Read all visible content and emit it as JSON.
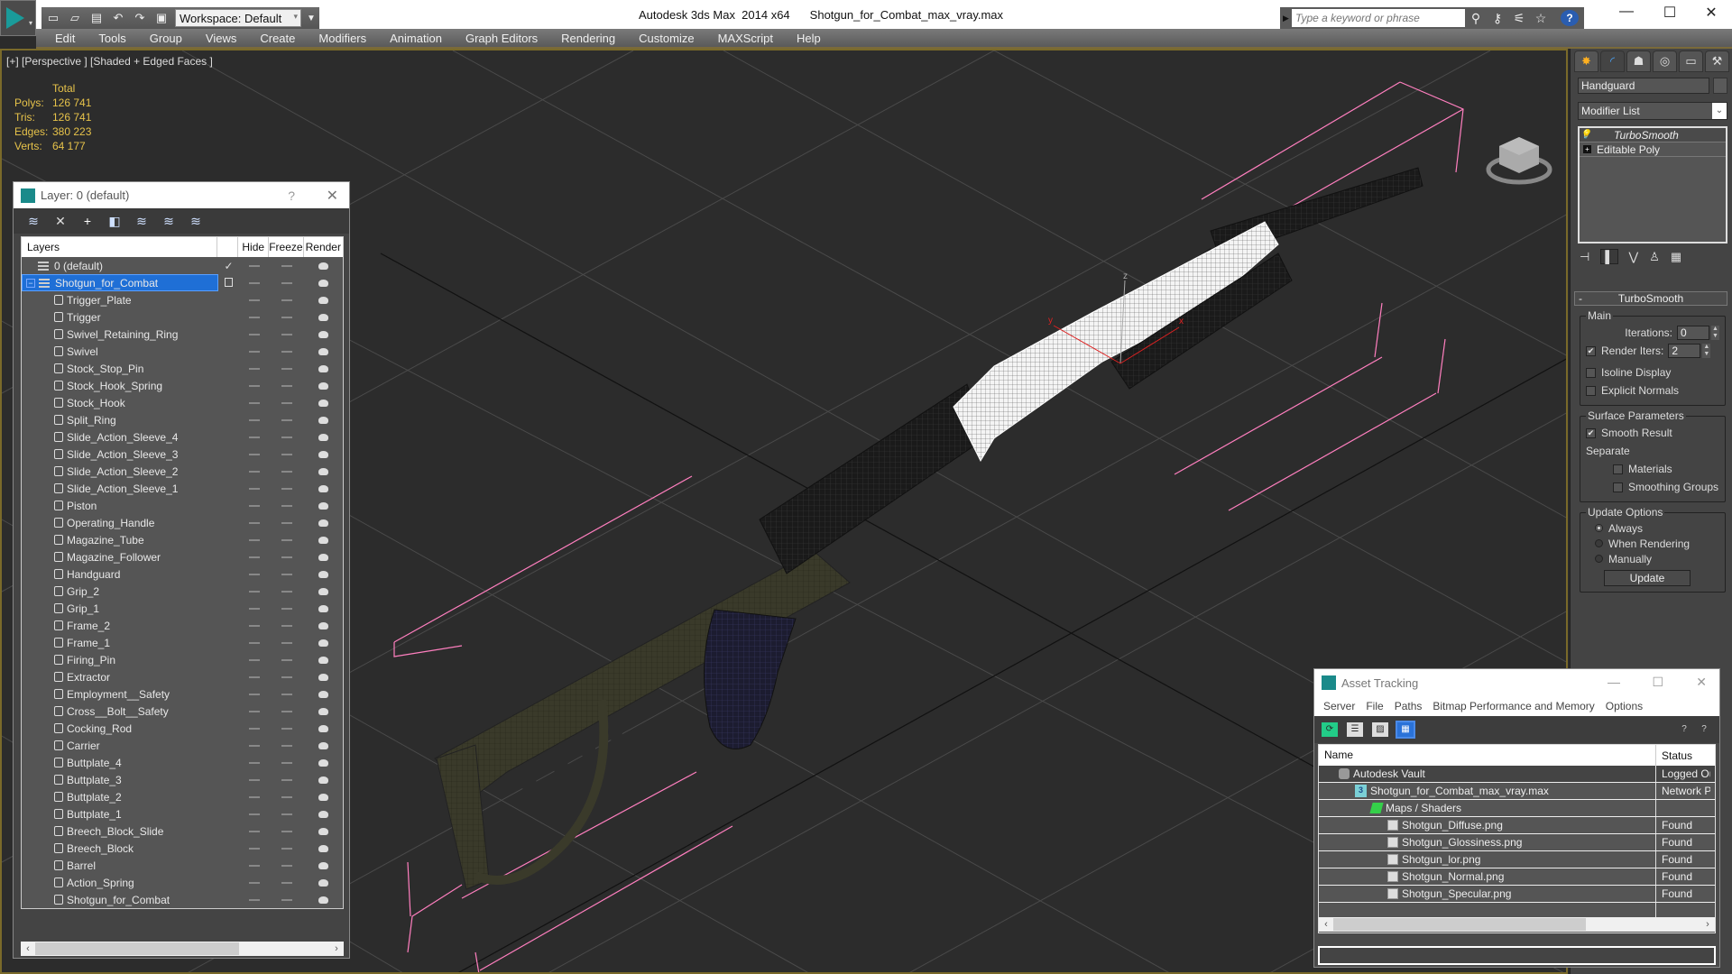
{
  "app": {
    "title": "Autodesk 3ds Max  2014 x64",
    "file": "Shotgun_for_Combat_max_vray.max",
    "workspace": "Workspace: Default",
    "search_placeholder": "Type a keyword or phrase",
    "window_controls": {
      "minimize": "—",
      "maximize": "☐",
      "close": "✕"
    }
  },
  "quick_access": [
    "new-file-icon",
    "open-file-icon",
    "save-icon",
    "undo-icon",
    "redo-icon",
    "project-folder-icon"
  ],
  "menu": [
    "Edit",
    "Tools",
    "Group",
    "Views",
    "Create",
    "Modifiers",
    "Animation",
    "Graph Editors",
    "Rendering",
    "Customize",
    "MAXScript",
    "Help"
  ],
  "viewport": {
    "label": "[+] [Perspective ] [Shaded + Edged Faces ]",
    "stats": {
      "header": "Total",
      "rows": [
        {
          "key": "Polys:",
          "value": "126 741"
        },
        {
          "key": "Tris:",
          "value": "126 741"
        },
        {
          "key": "Edges:",
          "value": "380 223"
        },
        {
          "key": "Verts:",
          "value": "64 177"
        }
      ]
    },
    "gizmo_axes": {
      "x": "x",
      "y": "y",
      "z": "z"
    }
  },
  "layer_dialog": {
    "title": "Layer: 0 (default)",
    "help": "?",
    "close": "✕",
    "columns": {
      "name": "Layers",
      "hide": "Hide",
      "freeze": "Freeze",
      "render": "Render"
    },
    "default_layer": "0 (default)",
    "selected_layer": "Shotgun_for_Combat",
    "objects": [
      "Trigger_Plate",
      "Trigger",
      "Swivel_Retaining_Ring",
      "Swivel",
      "Stock_Stop_Pin",
      "Stock_Hook_Spring",
      "Stock_Hook",
      "Split_Ring",
      "Slide_Action_Sleeve_4",
      "Slide_Action_Sleeve_3",
      "Slide_Action_Sleeve_2",
      "Slide_Action_Sleeve_1",
      "Piston",
      "Operating_Handle",
      "Magazine_Tube",
      "Magazine_Follower",
      "Handguard",
      "Grip_2",
      "Grip_1",
      "Frame_2",
      "Frame_1",
      "Firing_Pin",
      "Extractor",
      "Employment__Safety",
      "Cross__Bolt__Safety",
      "Cocking_Rod",
      "Carrier",
      "Buttplate_4",
      "Buttplate_3",
      "Buttplate_2",
      "Buttplate_1",
      "Breech_Block_Slide",
      "Breech_Block",
      "Barrel",
      "Action_Spring",
      "Shotgun_for_Combat"
    ]
  },
  "command_panel": {
    "tabs": [
      "create",
      "modify",
      "hierarchy",
      "motion",
      "display",
      "utilities"
    ],
    "active_tab": "modify",
    "object_name": "Handguard",
    "modifier_list": "Modifier List",
    "stack": [
      "TurboSmooth",
      "Editable Poly"
    ],
    "turbosmooth": {
      "title": "TurboSmooth",
      "main_label": "Main",
      "iterations_label": "Iterations:",
      "iterations": "0",
      "render_iters_label": "Render Iters:",
      "render_iters": "2",
      "render_iters_checked": true,
      "isoline_display": "Isoline Display",
      "explicit_normals": "Explicit Normals",
      "surface_params": "Surface Parameters",
      "smooth_result": "Smooth Result",
      "separate": "Separate",
      "materials": "Materials",
      "smoothing_groups": "Smoothing Groups",
      "update_options": "Update Options",
      "always": "Always",
      "when_rendering": "When Rendering",
      "manually": "Manually",
      "update_button": "Update"
    }
  },
  "asset_dialog": {
    "title": "Asset Tracking",
    "menu": [
      "Server",
      "File",
      "Paths",
      "Bitmap Performance and Memory",
      "Options"
    ],
    "columns": {
      "name": "Name",
      "status": "Status"
    },
    "rows": [
      {
        "name": "Autodesk Vault",
        "status": "Logged Ou",
        "icon": "vault"
      },
      {
        "name": "Shotgun_for_Combat_max_vray.max",
        "status": "Network Pa",
        "icon": "max"
      },
      {
        "name": "Maps / Shaders",
        "status": "",
        "icon": "maps"
      },
      {
        "name": "Shotgun_Diffuse.png",
        "status": "Found",
        "icon": "png"
      },
      {
        "name": "Shotgun_Glossiness.png",
        "status": "Found",
        "icon": "png"
      },
      {
        "name": "Shotgun_lor.png",
        "status": "Found",
        "icon": "png"
      },
      {
        "name": "Shotgun_Normal.png",
        "status": "Found",
        "icon": "png"
      },
      {
        "name": "Shotgun_Specular.png",
        "status": "Found",
        "icon": "png"
      }
    ]
  },
  "colors": {
    "accent_blue": "#1f6fd6",
    "stats_yellow": "#e6c24a",
    "bbox_pink": "#ff7fbf",
    "viewport_border": "#7a6a2a"
  }
}
